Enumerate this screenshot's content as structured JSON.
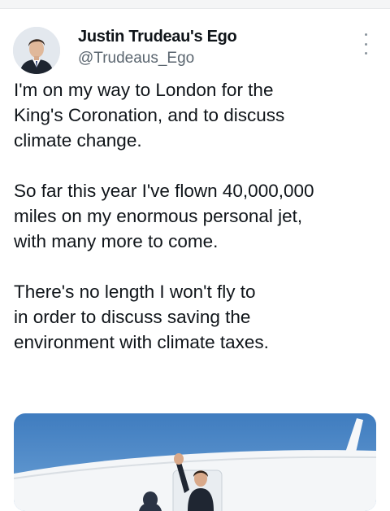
{
  "tweet": {
    "display_name": "Justin Trudeau's Ego",
    "handle": "@Trudeaus_Ego",
    "paragraphs": [
      "I'm on my way to London for the\nKing's Coronation, and to discuss\nclimate change.",
      "So far this year I've flown 40,000,000\nmiles on my enormous personal jet,\nwith many more to come.",
      "There's no length I won't fly to\nin order to discuss saving the\nenvironment with climate taxes."
    ],
    "icons": {
      "more": "more-vertical-icon"
    },
    "colors": {
      "text": "#0f1419",
      "secondary_text": "#5b6670",
      "sky": "#4a86c4",
      "jet": "#f4f6f8"
    }
  }
}
